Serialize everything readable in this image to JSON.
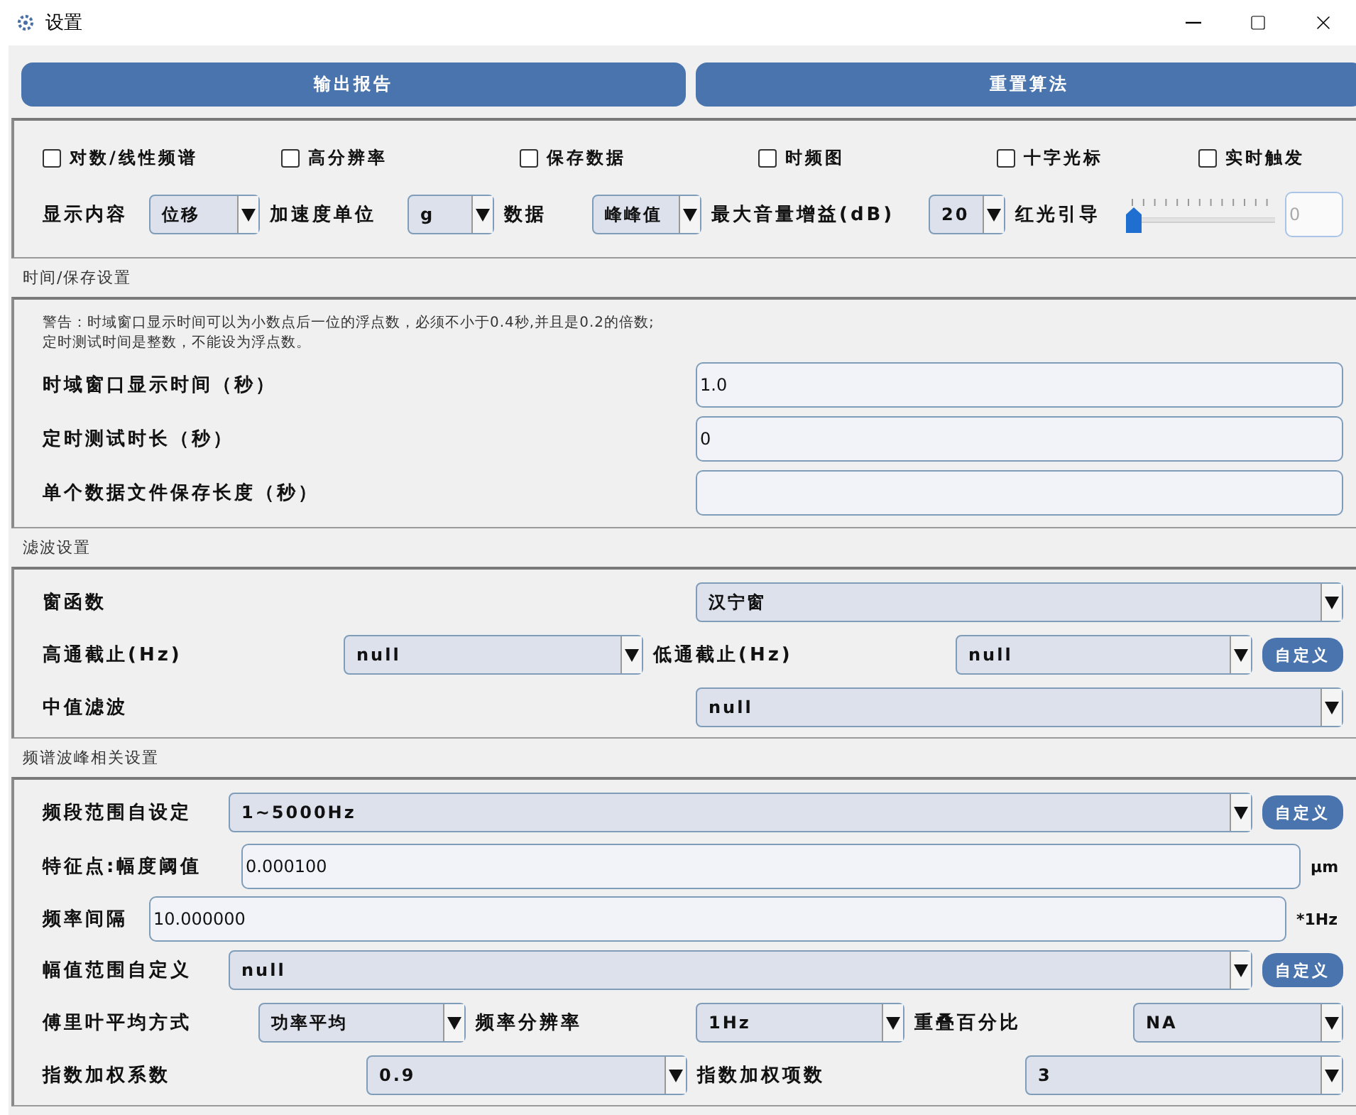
{
  "window": {
    "title": "设置"
  },
  "toolbar_buttons": [
    {
      "label": "输出报告"
    },
    {
      "label": "重置算法"
    }
  ],
  "options_panel": {
    "checkboxes": [
      {
        "label": "对数/线性频谱",
        "checked": false
      },
      {
        "label": "高分辨率",
        "checked": false
      },
      {
        "label": "保存数据",
        "checked": false
      },
      {
        "label": "时频图",
        "checked": false
      },
      {
        "label": "十字光标",
        "checked": false
      },
      {
        "label": "实时触发",
        "checked": false
      }
    ],
    "controls": [
      {
        "kind": "label",
        "text": "显示内容"
      },
      {
        "kind": "select",
        "value": "位移"
      },
      {
        "kind": "label",
        "text": "加速度单位"
      },
      {
        "kind": "select",
        "value": "g"
      },
      {
        "kind": "label",
        "text": "数据"
      },
      {
        "kind": "select",
        "value": "峰峰值"
      },
      {
        "kind": "label",
        "text": "最大音量增益(dB)"
      },
      {
        "kind": "select",
        "value": "20"
      },
      {
        "kind": "label",
        "text": "红光引导"
      },
      {
        "kind": "slider",
        "level": 0
      },
      {
        "kind": "input",
        "value": "0",
        "disabled": true
      }
    ]
  },
  "sections": [
    {
      "title": "时间/保存设置",
      "warning_lines": [
        "警告：时域窗口显示时间可以为小数点后一位的浮点数，必须不小于0.4秒,并且是0.2的倍数;",
        "定时测试时间是整数，不能设为浮点数。"
      ],
      "rows": [
        {
          "items": [
            {
              "kind": "label",
              "text": "时域窗口显示时间（秒）"
            },
            {
              "kind": "input",
              "value": "1.0",
              "disabled": false
            }
          ]
        },
        {
          "items": [
            {
              "kind": "label",
              "text": "定时测试时长（秒）"
            },
            {
              "kind": "input",
              "value": "0",
              "disabled": false
            }
          ]
        },
        {
          "items": [
            {
              "kind": "label",
              "text": "单个数据文件保存长度（秒）"
            },
            {
              "kind": "input",
              "disabled": false
            }
          ]
        }
      ]
    },
    {
      "title": "滤波设置",
      "rows": [
        {
          "items": [
            {
              "kind": "label",
              "text": "窗函数"
            },
            {
              "kind": "select",
              "value": "汉宁窗"
            }
          ]
        },
        {
          "items": [
            {
              "kind": "label",
              "text": "高通截止(Hz)"
            },
            {
              "kind": "select",
              "value": "null"
            },
            {
              "kind": "label",
              "text": "低通截止(Hz)"
            },
            {
              "kind": "select",
              "value": "null"
            },
            {
              "kind": "button",
              "label": "自定义"
            }
          ]
        },
        {
          "items": [
            {
              "kind": "label",
              "text": "中值滤波"
            },
            {
              "kind": "select",
              "value": "null"
            }
          ]
        }
      ]
    },
    {
      "title": "频谱波峰相关设置",
      "rows": [
        {
          "items": [
            {
              "kind": "label",
              "text": "频段范围自设定"
            },
            {
              "kind": "select",
              "value": "1~5000Hz"
            },
            {
              "kind": "button",
              "label": "自定义"
            }
          ]
        },
        {
          "items": [
            {
              "kind": "label",
              "text": "特征点:幅度阈值"
            },
            {
              "kind": "input",
              "value": "0.000100",
              "disabled": false
            },
            {
              "kind": "unit",
              "text": "μm"
            }
          ]
        },
        {
          "items": [
            {
              "kind": "label",
              "text": "频率间隔"
            },
            {
              "kind": "input",
              "value": "10.000000",
              "disabled": false
            },
            {
              "kind": "unit",
              "text": "*1Hz"
            }
          ]
        },
        {
          "items": [
            {
              "kind": "label",
              "text": "幅值范围自定义"
            },
            {
              "kind": "select",
              "value": "null"
            },
            {
              "kind": "button",
              "label": "自定义"
            }
          ]
        },
        {
          "items": [
            {
              "kind": "label",
              "text": "傅里叶平均方式"
            },
            {
              "kind": "select",
              "value": "功率平均"
            },
            {
              "kind": "label",
              "text": "频率分辨率"
            },
            {
              "kind": "select",
              "value": "1Hz"
            },
            {
              "kind": "label",
              "text": "重叠百分比"
            },
            {
              "kind": "select",
              "value": "NA"
            }
          ]
        },
        {
          "items": [
            {
              "kind": "label",
              "text": "指数加权系数"
            },
            {
              "kind": "select",
              "value": "0.9"
            },
            {
              "kind": "label",
              "text": "指数加权项数"
            },
            {
              "kind": "select",
              "value": "3"
            }
          ]
        }
      ]
    }
  ]
}
